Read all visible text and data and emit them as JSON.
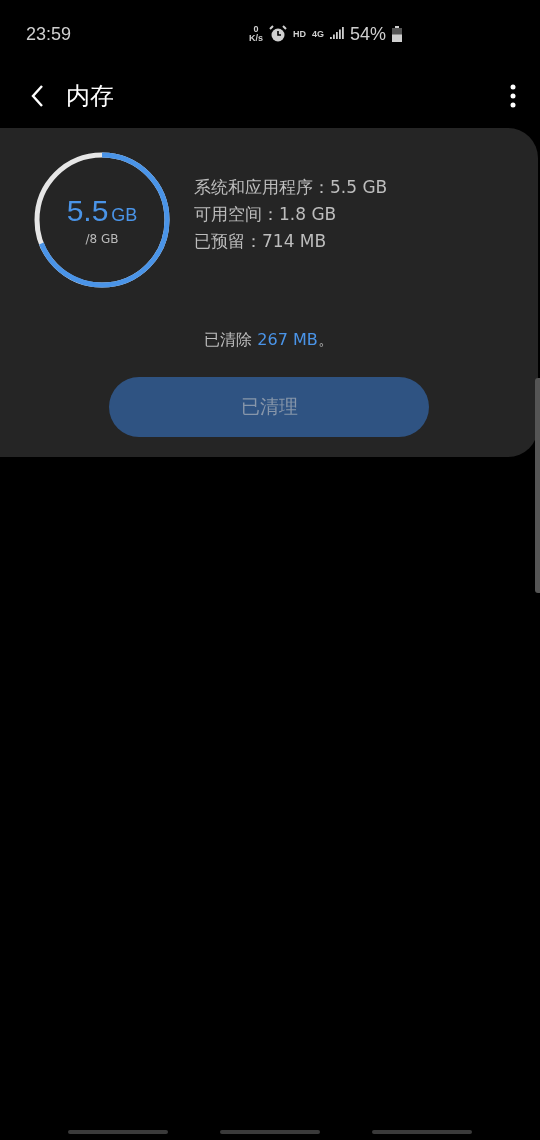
{
  "status_bar": {
    "time": "23:59",
    "net_speed_value": "0",
    "net_speed_unit": "K/s",
    "hd": "HD",
    "network": "4G",
    "battery": "54%"
  },
  "header": {
    "title": "内存"
  },
  "memory": {
    "used_value": "5.5",
    "used_unit": "GB",
    "total": "/8 GB",
    "details": [
      "系统和应用程序：5.5 GB",
      "可用空间：1.8 GB",
      "已预留：714 MB"
    ],
    "cleared_prefix": "已清除 ",
    "cleared_amount": "267 MB",
    "cleared_suffix": "。",
    "button": {
      "label": "已清理",
      "disabled": true
    }
  }
}
